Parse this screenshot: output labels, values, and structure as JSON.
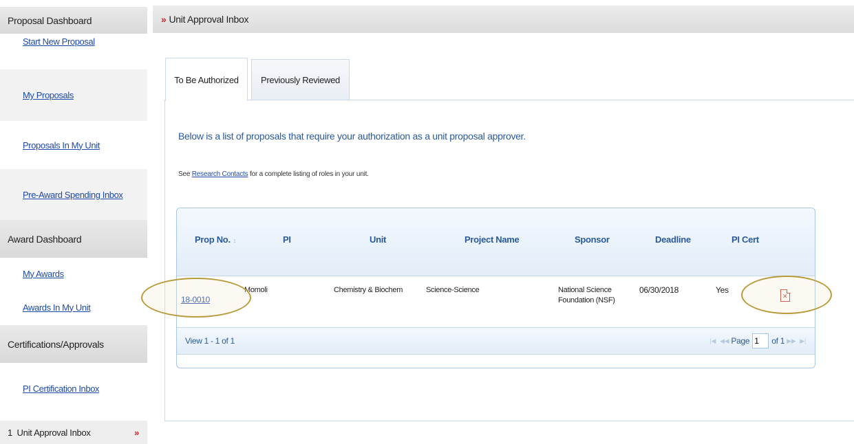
{
  "sidebar": {
    "proposal_dashboard": "Proposal Dashboard",
    "start_new_proposal": "Start New Proposal",
    "my_proposals": "My Proposals",
    "proposals_in_my_unit": "Proposals In My Unit",
    "pre_award_spending_inbox": "Pre-Award Spending Inbox",
    "award_dashboard": "Award Dashboard",
    "my_awards": "My Awards",
    "awards_in_my_unit": "Awards In My Unit",
    "certifications_approvals": "Certifications/Approvals",
    "pi_certification_inbox": "PI Certification Inbox",
    "unit_approval_inbox": "1  Unit Approval Inbox",
    "selected_chevron": "»"
  },
  "header": {
    "chevron": "»",
    "title": "Unit Approval Inbox"
  },
  "tabs": [
    {
      "label": "To Be Authorized",
      "active": true
    },
    {
      "label": "Previously Reviewed",
      "active": false
    }
  ],
  "intro_text": "Below is a list of proposals that require your authorization as a unit proposal approver.",
  "see_text": {
    "prefix": "See ",
    "link": "Research Contacts",
    "suffix": " for a complete listing of roles in your unit."
  },
  "grid": {
    "columns": [
      "Prop No.",
      "PI",
      "Unit",
      "Project Name",
      "Sponsor",
      "Deadline",
      "PI Cert"
    ],
    "sort_icon": "↕",
    "rows": [
      {
        "prop_no": "18-0010",
        "pi": "Momoli",
        "unit": "Chemistry & Biochem",
        "project_name": "Science-Science",
        "sponsor_line1": "National Science",
        "sponsor_line2": "Foundation (NSF)",
        "deadline": "06/30/2018",
        "pi_cert": "Yes",
        "pdf_icon": "pdf-icon"
      }
    ],
    "footer": {
      "view": "View 1 - 1 of 1",
      "page_label": "Page",
      "page_value": "1",
      "of_label": "of 1",
      "first": "|◀",
      "prev": "◀◀",
      "next": "▶▶",
      "last": "▶|"
    }
  },
  "colors": {
    "accent_red": "#d1222a",
    "link_blue": "#1f4aa8",
    "header_blue": "#2a5a9a",
    "highlight_ring": "#b89a3a"
  }
}
